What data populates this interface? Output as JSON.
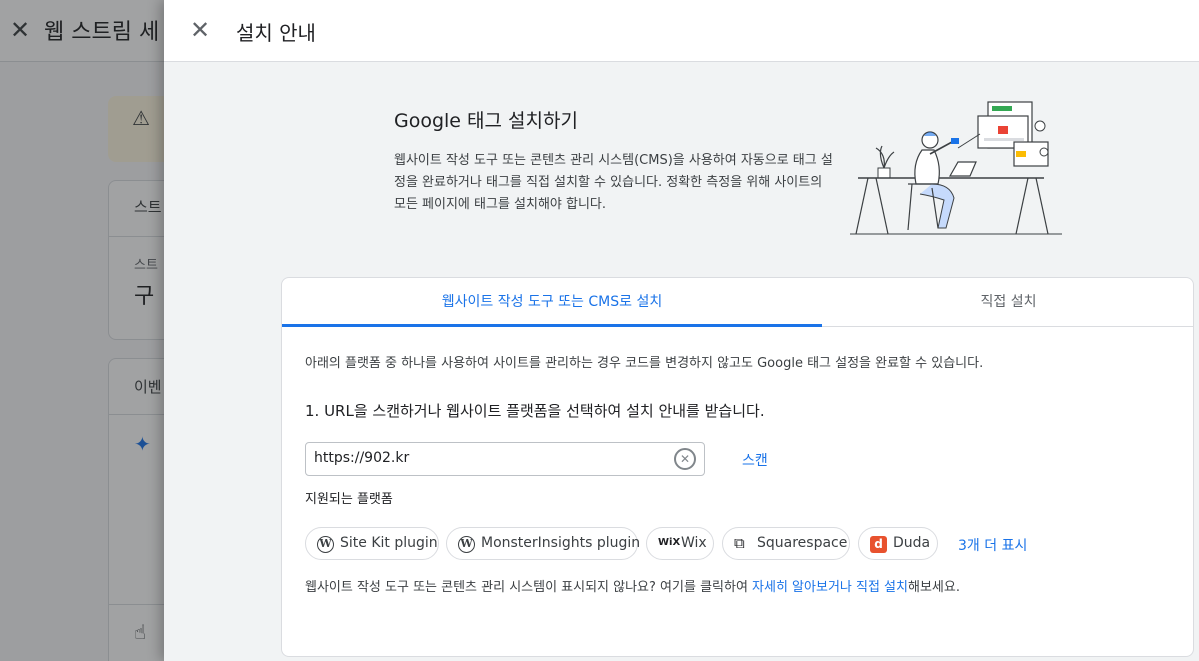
{
  "background": {
    "title": "웹 스트림 세",
    "card1_header": "스트",
    "card1_label": "스트",
    "card1_value": "구",
    "card2_header": "이벤"
  },
  "panel": {
    "title": "설치 안내"
  },
  "hero": {
    "title": "Google 태그 설치하기",
    "description": "웹사이트 작성 도구 또는 콘텐츠 관리 시스템(CMS)을 사용하여 자동으로 태그 설정을 완료하거나 태그를 직접 설치할 수 있습니다. 정확한 측정을 위해 사이트의 모든 페이지에 태그를 설치해야 합니다."
  },
  "tabs": [
    {
      "label": "웹사이트 작성 도구 또는 CMS로 설치",
      "selected": true
    },
    {
      "label": "직접 설치",
      "selected": false
    }
  ],
  "content": {
    "intro": "아래의 플랫폼 중 하나를 사용하여 사이트를 관리하는 경우 코드를 변경하지 않고도 Google 태그 설정을 완료할 수 있습니다.",
    "step": "1. URL을 스캔하거나 웹사이트 플랫폼을 선택하여 설치 안내를 받습니다.",
    "url_value": "https://902.kr",
    "scan_label": "스캔",
    "platforms_label": "지원되는 플랫폼",
    "platforms": [
      {
        "label": "Site Kit plugin",
        "icon": "wordpress-icon"
      },
      {
        "label": "MonsterInsights plugin",
        "icon": "wordpress-icon"
      },
      {
        "label": "Wix",
        "icon": "wix-icon",
        "icon_text": "WiX"
      },
      {
        "label": "Squarespace",
        "icon": "squarespace-icon"
      },
      {
        "label": "Duda",
        "icon": "duda-icon",
        "icon_text": "d"
      }
    ],
    "more_label": "3개 더 표시",
    "footer_prefix": "웹사이트 작성 도구 또는 콘텐츠 관리 시스템이 표시되지 않나요? 여기를 클릭하여 ",
    "footer_link1": "자세히 알아보거나",
    "footer_link2": "직접 설치",
    "footer_suffix": "해보세요."
  },
  "colors": {
    "accent": "#1a73e8",
    "duda": "#e8522e",
    "panel_bg": "#f1f3f4"
  }
}
